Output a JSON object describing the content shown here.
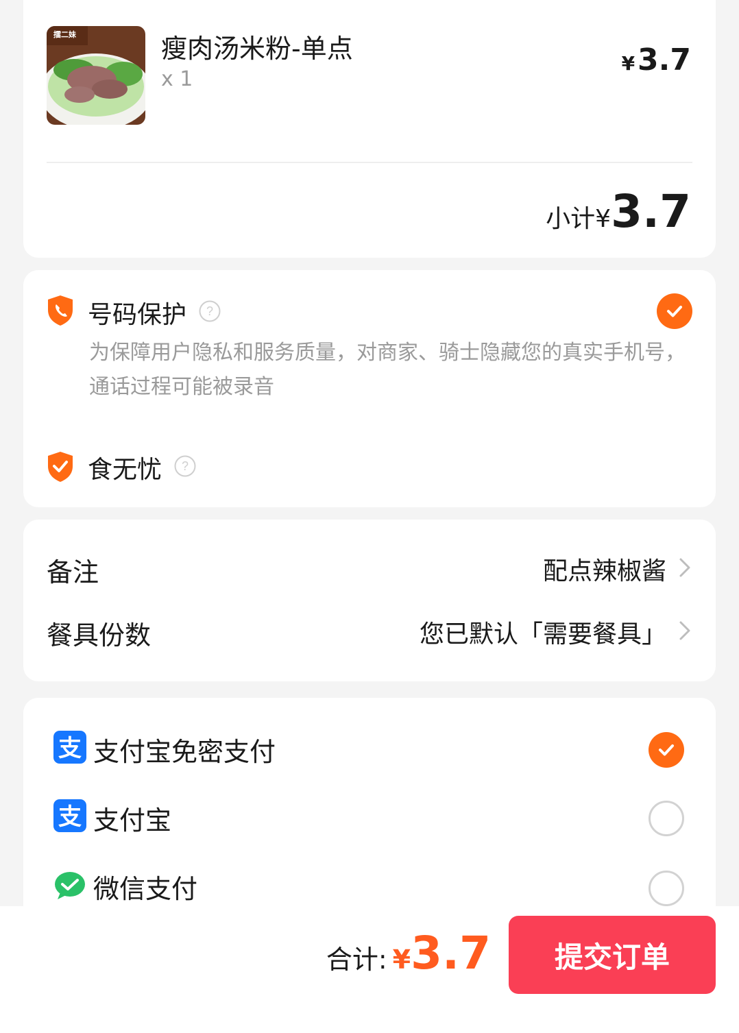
{
  "item": {
    "name": "瘦肉汤米粉-单点",
    "quantity": "x 1",
    "currency": "¥",
    "price": "3.7",
    "thumbnail_text": "擂二妹"
  },
  "subtotal": {
    "label": "小计",
    "currency": "¥",
    "value": "3.7"
  },
  "protection": {
    "number_protect": {
      "title": "号码保护",
      "description": "为保障用户隐私和服务质量，对商家、骑士隐藏您的真实手机号，通话过程可能被录音",
      "checked": true
    },
    "food_safe": {
      "title": "食无忧"
    }
  },
  "notes": {
    "remark": {
      "label": "备注",
      "value": "配点辣椒酱"
    },
    "utensils": {
      "label": "餐具份数",
      "value": "您已默认「需要餐具」"
    }
  },
  "payment": {
    "options": [
      {
        "label": "支付宝免密支付",
        "icon": "alipay-icon",
        "selected": true
      },
      {
        "label": "支付宝",
        "icon": "alipay-icon",
        "selected": false
      },
      {
        "label": "微信支付",
        "icon": "wechat-pay-icon",
        "selected": false
      }
    ]
  },
  "footer": {
    "total_label": "合计:",
    "currency": "¥",
    "total": "3.7",
    "submit_label": "提交订单"
  },
  "colors": {
    "accent": "#ff6a13",
    "price_accent": "#ff5b1f",
    "submit_bg": "#fa3f55",
    "alipay": "#1677ff",
    "wechat": "#2ac168"
  }
}
